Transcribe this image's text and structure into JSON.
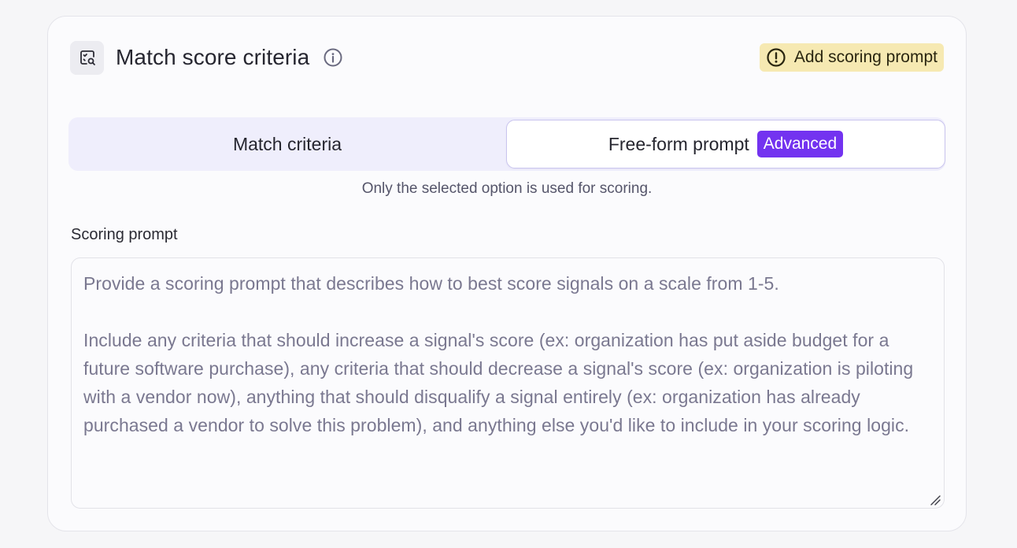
{
  "header": {
    "title": "Match score criteria",
    "icon": "search-list-icon",
    "info_icon": "info-icon",
    "warning_badge": {
      "label": "Add scoring prompt",
      "icon": "alert-circle-icon",
      "color": "#f6e9b2"
    }
  },
  "toggle": {
    "options": [
      {
        "label": "Match criteria",
        "selected": false
      },
      {
        "label": "Free-form prompt",
        "selected": true,
        "badge": "Advanced"
      }
    ],
    "hint": "Only the selected option is used for scoring.",
    "accent_color": "#7333f0"
  },
  "scoring_prompt": {
    "label": "Scoring prompt",
    "value": "",
    "placeholder": "Provide a scoring prompt that describes how to best score signals on a scale from 1-5.\n\nInclude any criteria that should increase a signal's score (ex: organization has put aside budget for a future software purchase), any criteria that should decrease a signal's score (ex: organization is piloting with a vendor now), anything that should disqualify a signal entirely (ex: organization has already purchased a vendor to solve this problem), and anything else you'd like to include in your scoring logic."
  }
}
